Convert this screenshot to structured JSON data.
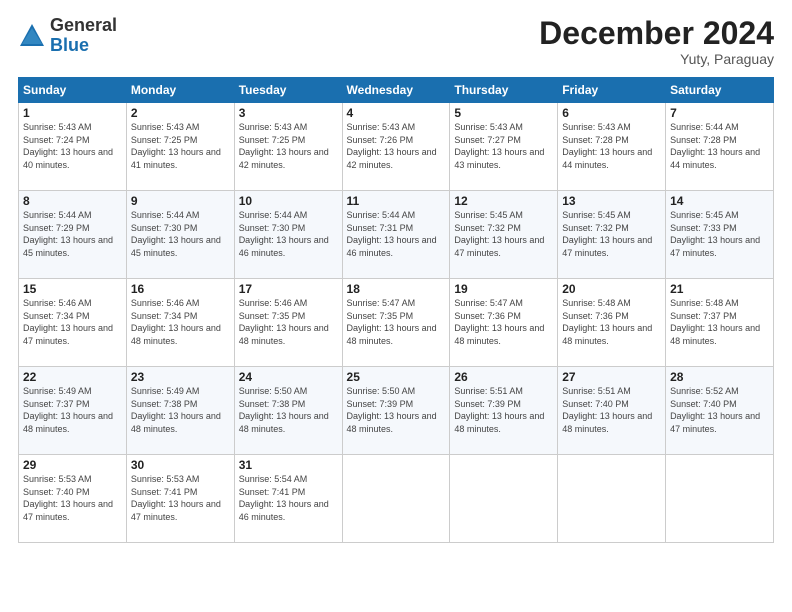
{
  "logo": {
    "general": "General",
    "blue": "Blue"
  },
  "title": "December 2024",
  "location": "Yuty, Paraguay",
  "days_header": [
    "Sunday",
    "Monday",
    "Tuesday",
    "Wednesday",
    "Thursday",
    "Friday",
    "Saturday"
  ],
  "weeks": [
    [
      {
        "day": "1",
        "sunrise": "5:43 AM",
        "sunset": "7:24 PM",
        "daylight": "13 hours and 40 minutes."
      },
      {
        "day": "2",
        "sunrise": "5:43 AM",
        "sunset": "7:25 PM",
        "daylight": "13 hours and 41 minutes."
      },
      {
        "day": "3",
        "sunrise": "5:43 AM",
        "sunset": "7:25 PM",
        "daylight": "13 hours and 42 minutes."
      },
      {
        "day": "4",
        "sunrise": "5:43 AM",
        "sunset": "7:26 PM",
        "daylight": "13 hours and 42 minutes."
      },
      {
        "day": "5",
        "sunrise": "5:43 AM",
        "sunset": "7:27 PM",
        "daylight": "13 hours and 43 minutes."
      },
      {
        "day": "6",
        "sunrise": "5:43 AM",
        "sunset": "7:28 PM",
        "daylight": "13 hours and 44 minutes."
      },
      {
        "day": "7",
        "sunrise": "5:44 AM",
        "sunset": "7:28 PM",
        "daylight": "13 hours and 44 minutes."
      }
    ],
    [
      {
        "day": "8",
        "sunrise": "5:44 AM",
        "sunset": "7:29 PM",
        "daylight": "13 hours and 45 minutes."
      },
      {
        "day": "9",
        "sunrise": "5:44 AM",
        "sunset": "7:30 PM",
        "daylight": "13 hours and 45 minutes."
      },
      {
        "day": "10",
        "sunrise": "5:44 AM",
        "sunset": "7:30 PM",
        "daylight": "13 hours and 46 minutes."
      },
      {
        "day": "11",
        "sunrise": "5:44 AM",
        "sunset": "7:31 PM",
        "daylight": "13 hours and 46 minutes."
      },
      {
        "day": "12",
        "sunrise": "5:45 AM",
        "sunset": "7:32 PM",
        "daylight": "13 hours and 47 minutes."
      },
      {
        "day": "13",
        "sunrise": "5:45 AM",
        "sunset": "7:32 PM",
        "daylight": "13 hours and 47 minutes."
      },
      {
        "day": "14",
        "sunrise": "5:45 AM",
        "sunset": "7:33 PM",
        "daylight": "13 hours and 47 minutes."
      }
    ],
    [
      {
        "day": "15",
        "sunrise": "5:46 AM",
        "sunset": "7:34 PM",
        "daylight": "13 hours and 47 minutes."
      },
      {
        "day": "16",
        "sunrise": "5:46 AM",
        "sunset": "7:34 PM",
        "daylight": "13 hours and 48 minutes."
      },
      {
        "day": "17",
        "sunrise": "5:46 AM",
        "sunset": "7:35 PM",
        "daylight": "13 hours and 48 minutes."
      },
      {
        "day": "18",
        "sunrise": "5:47 AM",
        "sunset": "7:35 PM",
        "daylight": "13 hours and 48 minutes."
      },
      {
        "day": "19",
        "sunrise": "5:47 AM",
        "sunset": "7:36 PM",
        "daylight": "13 hours and 48 minutes."
      },
      {
        "day": "20",
        "sunrise": "5:48 AM",
        "sunset": "7:36 PM",
        "daylight": "13 hours and 48 minutes."
      },
      {
        "day": "21",
        "sunrise": "5:48 AM",
        "sunset": "7:37 PM",
        "daylight": "13 hours and 48 minutes."
      }
    ],
    [
      {
        "day": "22",
        "sunrise": "5:49 AM",
        "sunset": "7:37 PM",
        "daylight": "13 hours and 48 minutes."
      },
      {
        "day": "23",
        "sunrise": "5:49 AM",
        "sunset": "7:38 PM",
        "daylight": "13 hours and 48 minutes."
      },
      {
        "day": "24",
        "sunrise": "5:50 AM",
        "sunset": "7:38 PM",
        "daylight": "13 hours and 48 minutes."
      },
      {
        "day": "25",
        "sunrise": "5:50 AM",
        "sunset": "7:39 PM",
        "daylight": "13 hours and 48 minutes."
      },
      {
        "day": "26",
        "sunrise": "5:51 AM",
        "sunset": "7:39 PM",
        "daylight": "13 hours and 48 minutes."
      },
      {
        "day": "27",
        "sunrise": "5:51 AM",
        "sunset": "7:40 PM",
        "daylight": "13 hours and 48 minutes."
      },
      {
        "day": "28",
        "sunrise": "5:52 AM",
        "sunset": "7:40 PM",
        "daylight": "13 hours and 47 minutes."
      }
    ],
    [
      {
        "day": "29",
        "sunrise": "5:53 AM",
        "sunset": "7:40 PM",
        "daylight": "13 hours and 47 minutes."
      },
      {
        "day": "30",
        "sunrise": "5:53 AM",
        "sunset": "7:41 PM",
        "daylight": "13 hours and 47 minutes."
      },
      {
        "day": "31",
        "sunrise": "5:54 AM",
        "sunset": "7:41 PM",
        "daylight": "13 hours and 46 minutes."
      },
      null,
      null,
      null,
      null
    ]
  ],
  "labels": {
    "sunrise": "Sunrise:",
    "sunset": "Sunset:",
    "daylight": "Daylight:"
  }
}
